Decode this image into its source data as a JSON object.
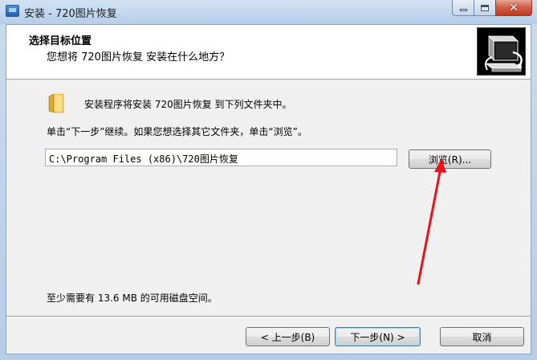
{
  "window": {
    "title": "安装 - 720图片恢复"
  },
  "header": {
    "title": "选择目标位置",
    "subtitle": "您想将 720图片恢复 安装在什么地方？"
  },
  "content": {
    "install_msg": "安装程序将安装 720图片恢复 到下列文件夹中。",
    "continue_msg": "单击“下一步”继续。如果您想选择其它文件夹，单击“浏览”。",
    "path_value": "C:\\Program Files (x86)\\720图片恢复",
    "browse_label": "浏览(R)...",
    "space_msg": "至少需要有 13.6 MB 的可用磁盘空间。"
  },
  "footer": {
    "back_label": "< 上一步(B)",
    "next_label": "下一步(N) >",
    "cancel_label": "取消"
  },
  "icons": {
    "folder": "folder-icon",
    "setup_image": "computer-install-icon"
  },
  "colors": {
    "annotation_arrow": "#e8141c"
  }
}
